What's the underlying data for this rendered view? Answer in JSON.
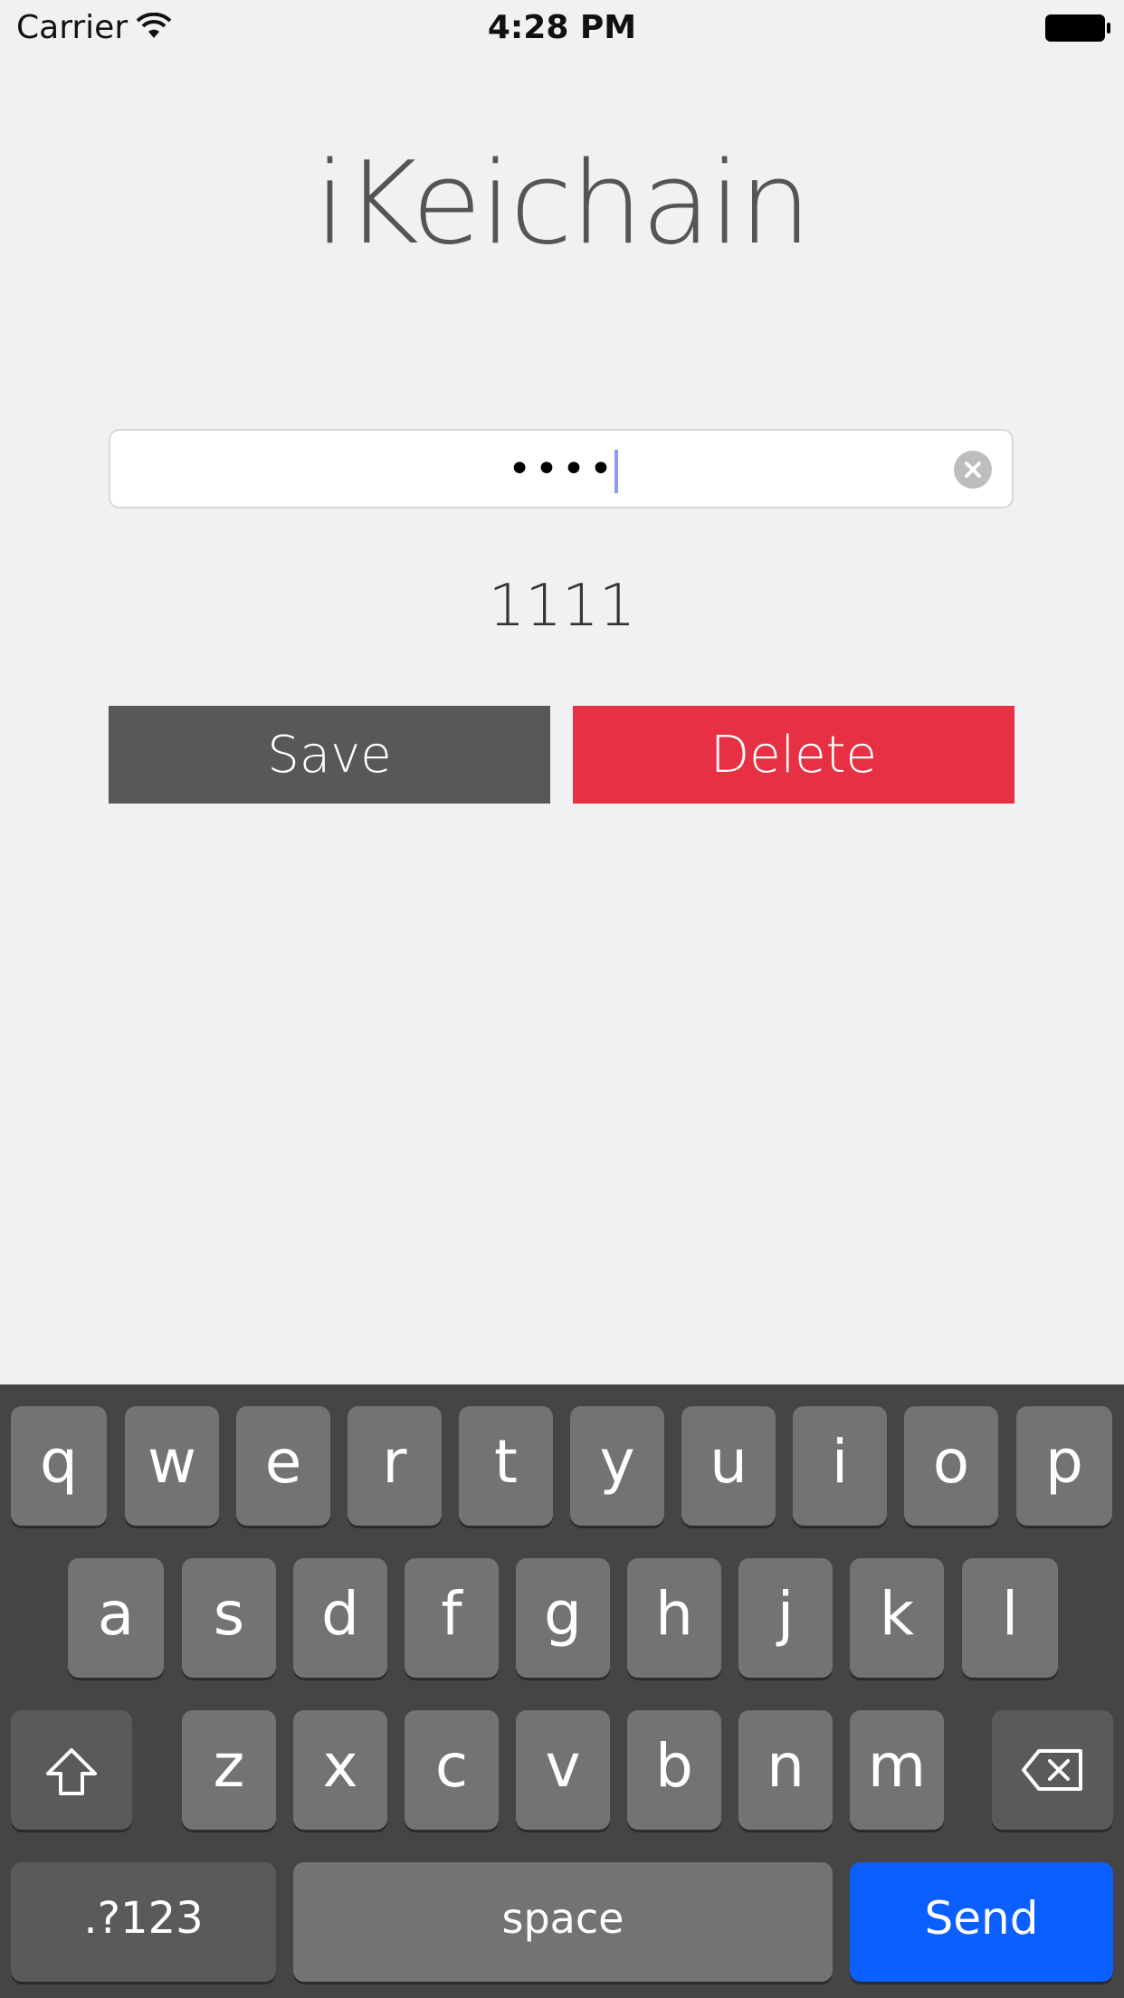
{
  "status_bar": {
    "carrier": "Carrier",
    "time": "4:28 PM",
    "icons": [
      "wifi-icon",
      "battery-icon"
    ]
  },
  "app": {
    "title": "iKeichain",
    "password_field": {
      "masked_value": "••••",
      "icons": [
        "clear-icon"
      ]
    },
    "stored_value": "1111",
    "save_label": "Save",
    "delete_label": "Delete",
    "colors": {
      "save": "#585858",
      "delete": "#e73043",
      "send": "#0a5ffe"
    }
  },
  "keyboard": {
    "row1": [
      "q",
      "w",
      "e",
      "r",
      "t",
      "y",
      "u",
      "i",
      "o",
      "p"
    ],
    "row2": [
      "a",
      "s",
      "d",
      "f",
      "g",
      "h",
      "j",
      "k",
      "l"
    ],
    "row3": [
      "z",
      "x",
      "c",
      "v",
      "b",
      "n",
      "m"
    ],
    "numbers_label": ".?123",
    "space_label": "space",
    "send_label": "Send",
    "icons": [
      "shift-icon",
      "backspace-icon"
    ]
  }
}
